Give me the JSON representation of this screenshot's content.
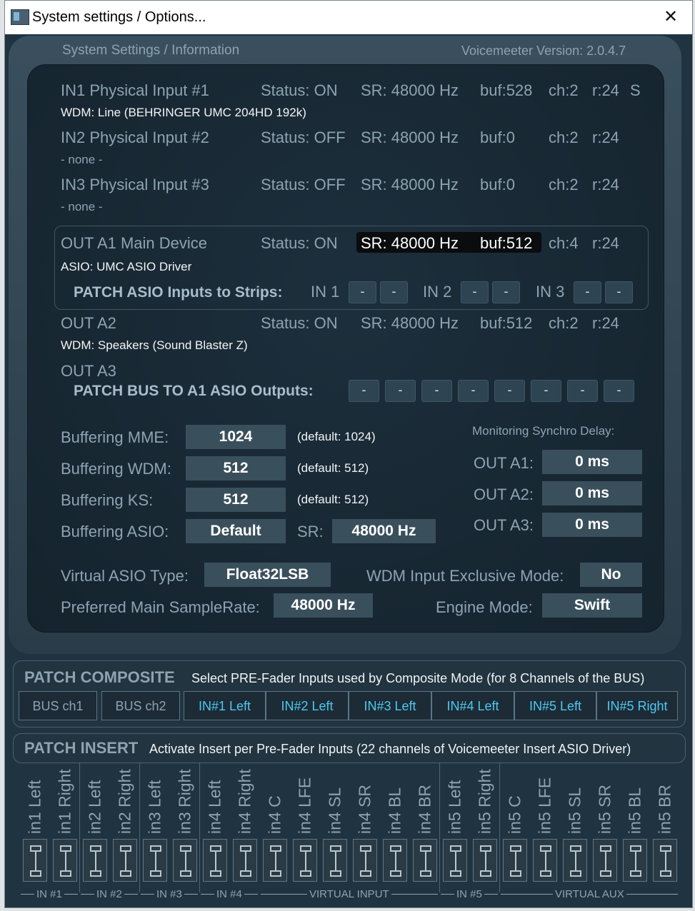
{
  "window": {
    "title": "System settings / Options...",
    "close_glyph": "✕"
  },
  "header": {
    "left": "System Settings / Information",
    "version": "Voicemeeter Version: 2.0.4.7"
  },
  "devices": [
    {
      "name": "IN1 Physical Input #1",
      "status": "Status: ON",
      "sr": "SR: 48000 Hz",
      "buf": "buf:528",
      "ch": "ch:2",
      "r": "r:24",
      "extra": "S",
      "driver": "WDM: Line (BEHRINGER UMC 204HD 192k)"
    },
    {
      "name": "IN2 Physical Input #2",
      "status": "Status: OFF",
      "sr": "SR: 48000 Hz",
      "buf": "buf:0",
      "ch": "ch:2",
      "r": "r:24",
      "driver": "- none -"
    },
    {
      "name": "IN3 Physical Input #3",
      "status": "Status: OFF",
      "sr": "SR: 48000 Hz",
      "buf": "buf:0",
      "ch": "ch:2",
      "r": "r:24",
      "driver": "- none -"
    },
    {
      "name": "OUT A1 Main Device",
      "status": "Status: ON",
      "sr": "SR: 48000 Hz",
      "buf": "buf:512",
      "ch": "ch:4",
      "r": "r:24",
      "driver": "ASIO: UMC ASIO Driver"
    },
    {
      "name": "OUT A2",
      "status": "Status: ON",
      "sr": "SR: 48000 Hz",
      "buf": "buf:512",
      "ch": "ch:2",
      "r": "r:24",
      "driver": "WDM: Speakers (Sound Blaster Z)"
    },
    {
      "name": "OUT A3"
    }
  ],
  "patch_asio": {
    "label": "PATCH ASIO Inputs to Strips:",
    "in1": "IN 1",
    "in2": "IN 2",
    "in3": "IN 3",
    "btn": "-"
  },
  "patch_bus": {
    "label": "PATCH BUS TO A1 ASIO Outputs:",
    "btn": "-"
  },
  "buffering": {
    "mme_label": "Buffering MME:",
    "mme_val": "1024",
    "mme_def": "(default: 1024)",
    "wdm_label": "Buffering WDM:",
    "wdm_val": "512",
    "wdm_def": "(default: 512)",
    "ks_label": "Buffering KS:",
    "ks_val": "512",
    "ks_def": "(default: 512)",
    "asio_label": "Buffering ASIO:",
    "asio_val": "Default",
    "sr_label": "SR:",
    "sr_val": "48000 Hz"
  },
  "monitoring": {
    "title": "Monitoring Synchro Delay:",
    "a1_label": "OUT A1:",
    "a1_val": "0 ms",
    "a2_label": "OUT A2:",
    "a2_val": "0 ms",
    "a3_label": "OUT A3:",
    "a3_val": "0 ms"
  },
  "misc": {
    "vasio_label": "Virtual ASIO Type:",
    "vasio_val": "Float32LSB",
    "wdm_ex_label": "WDM Input Exclusive Mode:",
    "wdm_ex_val": "No",
    "pref_sr_label": "Preferred Main SampleRate:",
    "pref_sr_val": "48000 Hz",
    "engine_label": "Engine Mode:",
    "engine_val": "Swift"
  },
  "patch_composite": {
    "title": "PATCH COMPOSITE",
    "desc": "Select PRE-Fader Inputs used by Composite Mode (for 8 Channels of the BUS)",
    "buttons": [
      "BUS ch1",
      "BUS ch2",
      "IN#1 Left",
      "IN#2 Left",
      "IN#3 Left",
      "IN#4 Left",
      "IN#5 Left",
      "IN#5 Right"
    ]
  },
  "patch_insert": {
    "title": "PATCH INSERT",
    "desc": "Activate Insert per Pre-Fader Inputs (22 channels of Voicemeeter Insert ASIO Driver)",
    "channels": [
      "in1 Left",
      "in1 Right",
      "in2 Left",
      "in2 Right",
      "in3 Left",
      "in3 Right",
      "in4 Left",
      "in4 Right",
      "in4 C",
      "in4 LFE",
      "in4 SL",
      "in4 SR",
      "in4 BL",
      "in4 BR",
      "in5 Left",
      "in5 Right",
      "in5 C",
      "in5 LFE",
      "in5 SL",
      "in5 SR",
      "in5 BL",
      "in5 BR"
    ],
    "groups": [
      "IN #1",
      "IN #2",
      "IN #3",
      "IN #4",
      "VIRTUAL INPUT",
      "IN #5",
      "VIRTUAL AUX"
    ]
  },
  "colors": {
    "bg": "#203340",
    "accent": "#4ec9ee",
    "value_box": "#3a4f5c"
  }
}
